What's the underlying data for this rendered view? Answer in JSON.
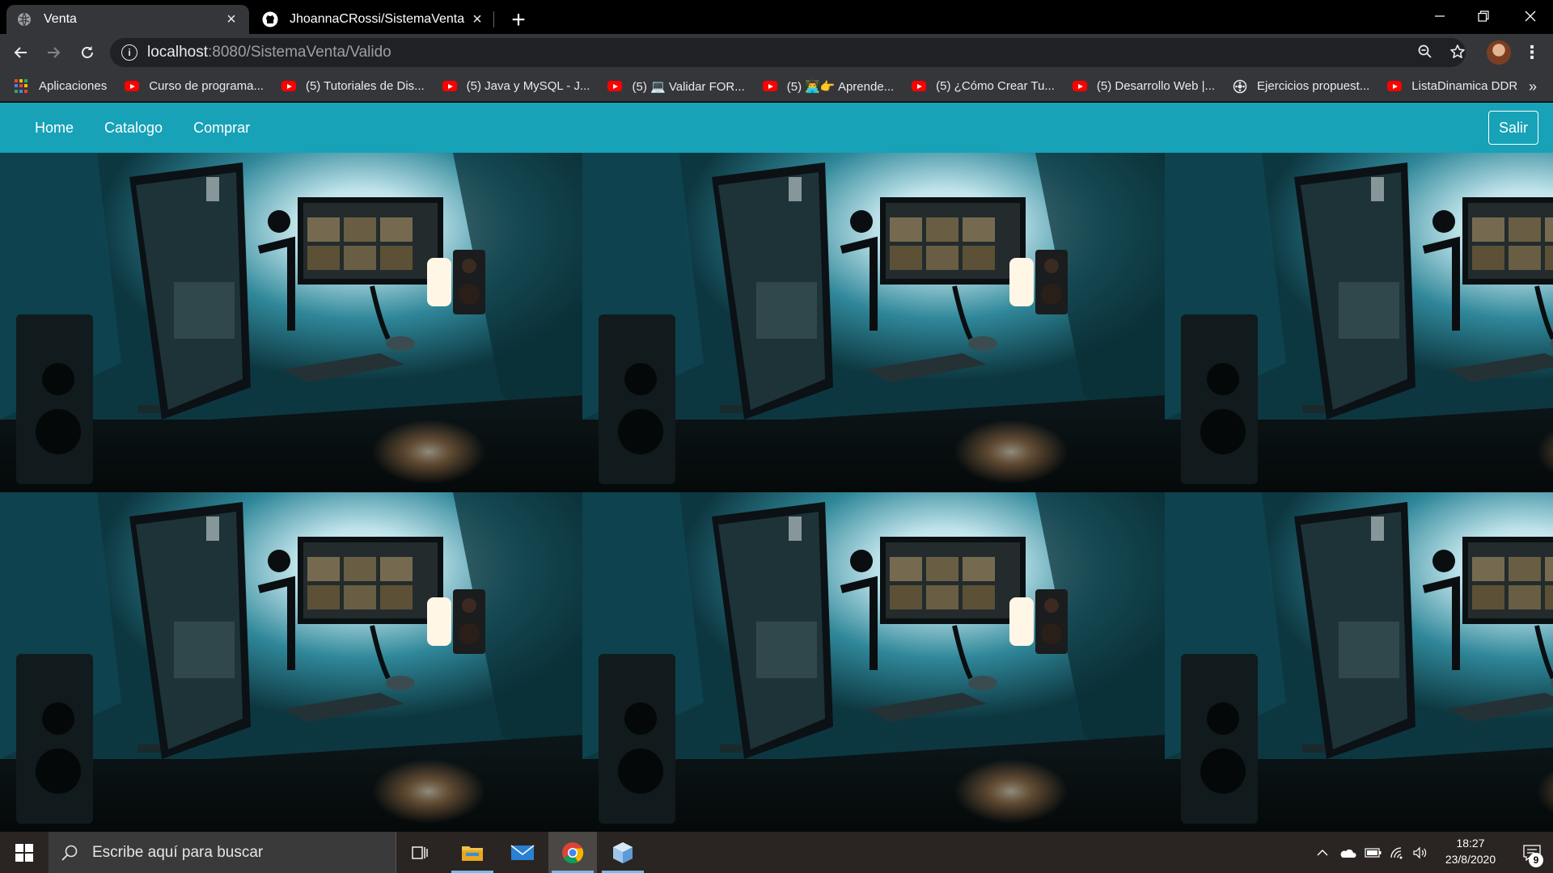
{
  "browser": {
    "tabs": [
      {
        "title": "Venta",
        "active": true,
        "favicon": "globe-icon"
      },
      {
        "title": "JhoannaCRossi/SistemaVenta",
        "active": false,
        "favicon": "github-icon"
      }
    ],
    "address": {
      "host": "localhost",
      "path": ":8080/SistemaVenta/Valido"
    },
    "bookmarks": [
      {
        "label": "Aplicaciones",
        "icon": "apps-grid-icon"
      },
      {
        "label": "Curso de programa...",
        "icon": "youtube-icon"
      },
      {
        "label": "(5) Tutoriales de Dis...",
        "icon": "youtube-icon"
      },
      {
        "label": "(5) Java y MySQL - J...",
        "icon": "youtube-icon"
      },
      {
        "label": "(5) 💻 Validar FOR...",
        "icon": "youtube-icon"
      },
      {
        "label": "(5) 👨‍💻👉 Aprende...",
        "icon": "youtube-icon"
      },
      {
        "label": "(5) ¿Cómo Crear Tu...",
        "icon": "youtube-icon"
      },
      {
        "label": "(5) Desarrollo Web |...",
        "icon": "youtube-icon"
      },
      {
        "label": "Ejercicios propuest...",
        "icon": "reel-icon"
      },
      {
        "label": "ListaDinamica DDR",
        "icon": "youtube-icon"
      }
    ],
    "more_bookmarks": "»"
  },
  "page": {
    "nav": {
      "links": [
        "Home",
        "Catalogo",
        "Comprar"
      ],
      "logout": "Salir"
    },
    "accent_color": "#17a2b8"
  },
  "taskbar": {
    "search_placeholder": "Escribe aquí para buscar",
    "time": "18:27",
    "date": "23/8/2020",
    "notification_count": "9"
  }
}
